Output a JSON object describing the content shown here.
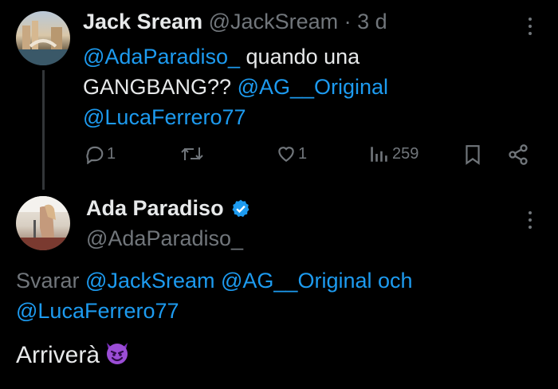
{
  "parent_tweet": {
    "author_name": "Jack Sream",
    "handle": "@JackSream",
    "separator": "·",
    "time": "3 d",
    "text_mention1": "@AdaParadiso_",
    "text_plain1": " quando una",
    "text_plain2": "GANGBANG?? ",
    "text_mention2": "@AG__Original",
    "text_mention3": "@LucaFerrero77",
    "stats": {
      "replies": "1",
      "likes": "1",
      "views": "259"
    }
  },
  "reply_tweet": {
    "author_name": "Ada Paradiso",
    "handle": "@AdaParadiso_",
    "verified": true,
    "replying_label": "Svarar ",
    "replying_mention1": "@JackSream",
    "replying_mention2": "@AG__Original",
    "replying_conj": "och",
    "replying_mention3": "@LucaFerrero77",
    "text": "Arriverà ",
    "emoji": "😈"
  },
  "colors": {
    "accent": "#1d9bf0",
    "muted": "#71767b",
    "text": "#e7e9ea",
    "bg": "#000000"
  }
}
